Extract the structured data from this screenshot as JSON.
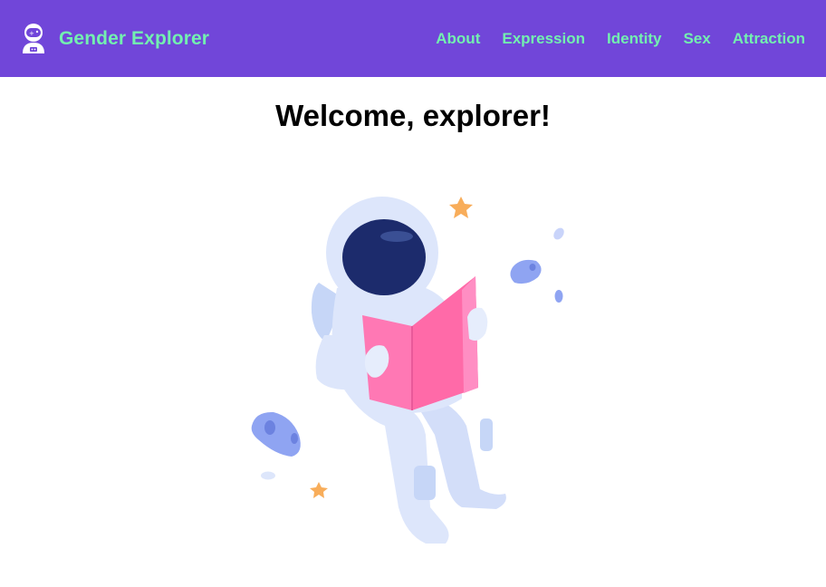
{
  "brand": {
    "name": "Gender Explorer",
    "logo_icon": "astronaut-icon"
  },
  "nav": {
    "items": [
      {
        "label": "About"
      },
      {
        "label": "Expression"
      },
      {
        "label": "Identity"
      },
      {
        "label": "Sex"
      },
      {
        "label": "Attraction"
      }
    ]
  },
  "main": {
    "heading": "Welcome, explorer!",
    "illustration_icon": "astronaut-reading-illustration"
  },
  "colors": {
    "navbar_bg": "#7146d9",
    "nav_text": "#73f0b0",
    "heading_text": "#000000",
    "suit": "#dde6fb",
    "visor": "#1b2a6b",
    "book": "#ff78b4",
    "star": "#f8ad5a",
    "asteroid": "#8fa4f2"
  }
}
